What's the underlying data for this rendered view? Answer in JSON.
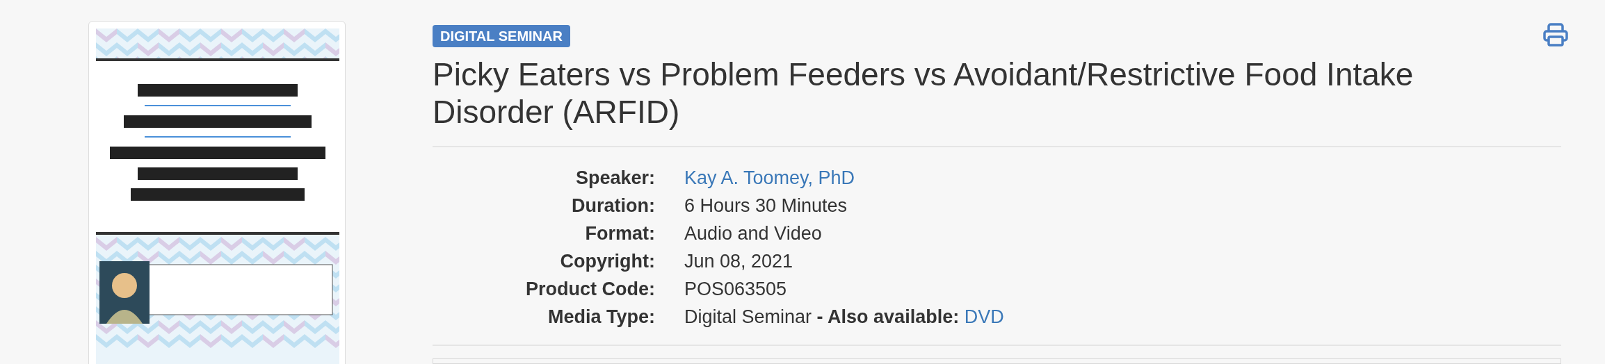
{
  "badge": "DIGITAL SEMINAR",
  "title": "Picky Eaters vs Problem Feeders vs Avoidant/Restrictive Food Intake Disorder (ARFID)",
  "details": [
    {
      "label": "Speaker:",
      "kind": "link",
      "value": "Kay A. Toomey, PhD"
    },
    {
      "label": "Duration:",
      "kind": "text",
      "value": "6 Hours 30 Minutes"
    },
    {
      "label": "Format:",
      "kind": "text",
      "value": "Audio and Video"
    },
    {
      "label": "Copyright:",
      "kind": "text",
      "value": "Jun 08, 2021"
    },
    {
      "label": "Product Code:",
      "kind": "text",
      "value": "POS063505"
    },
    {
      "label": "Media Type:",
      "kind": "text_with_link",
      "value": "Digital Seminar **- Also available:**",
      "link": "DVD"
    }
  ]
}
